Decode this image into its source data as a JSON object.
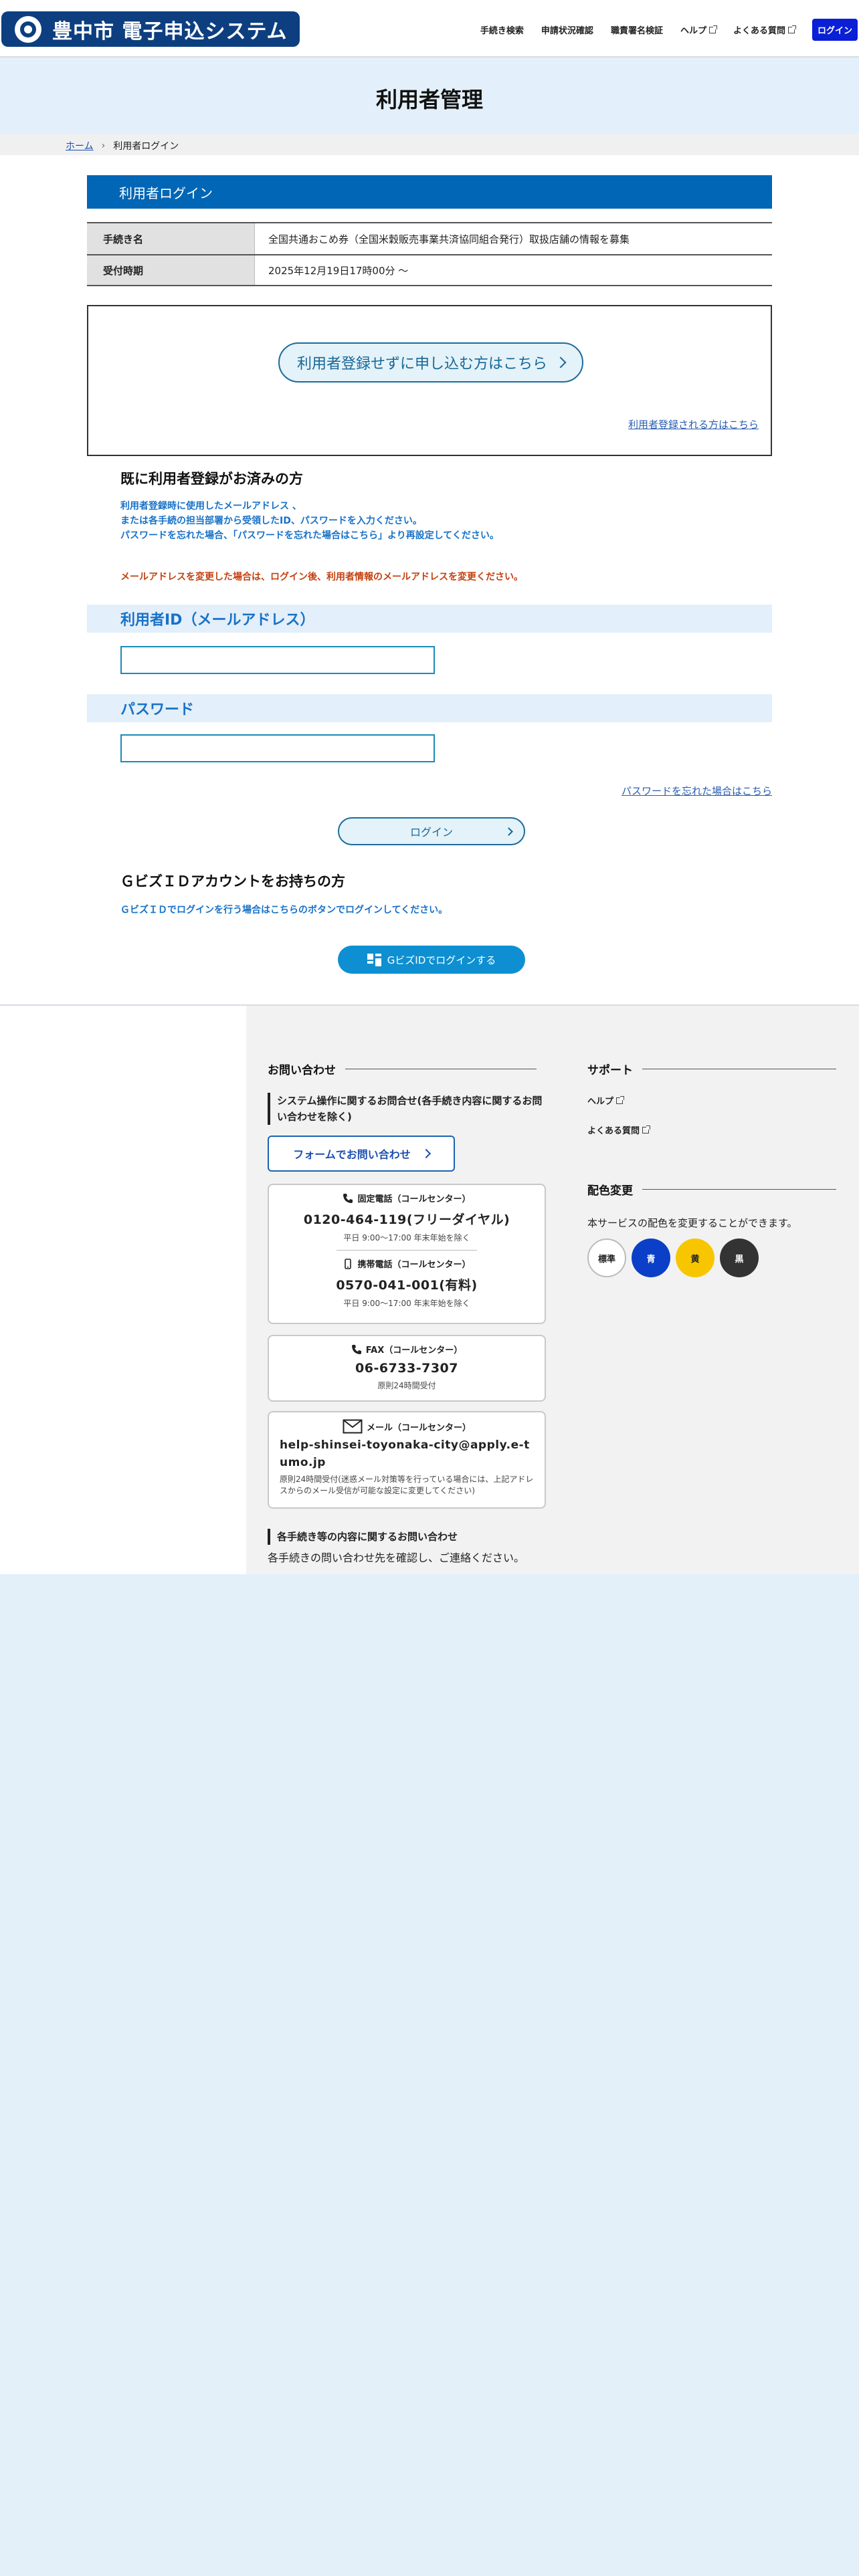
{
  "header": {
    "logo_text": "豊中市 電子申込システム",
    "nav": [
      "手続き検索",
      "申請状況確認",
      "職責署名検証",
      "ヘルプ",
      "よくある質問"
    ],
    "login": "ログイン"
  },
  "page_title": "利用者管理",
  "breadcrumb": {
    "home": "ホーム",
    "current": "利用者ログイン"
  },
  "login_section": {
    "title": "利用者ログイン",
    "rows": [
      {
        "label": "手続き名",
        "value": "全国共通おこめ券（全国米穀販売事業共済協同組合発行）取扱店舗の情報を募集"
      },
      {
        "label": "受付時期",
        "value": "2025年12月19日17時00分 〜"
      }
    ],
    "apply_without_register": "利用者登録せずに申し込む方はこちら",
    "register_link": "利用者登録される方はこちら"
  },
  "existing": {
    "title": "既に利用者登録がお済みの方",
    "desc_lines": [
      "利用者登録時に使用したメールアドレス 、",
      "または各手続の担当部署から受領したID、パスワードを入力ください。",
      "パスワードを忘れた場合、「パスワードを忘れた場合はこちら」より再設定してください。"
    ],
    "warning": "メールアドレスを変更した場合は、ログイン後、利用者情報のメールアドレスを変更ください。",
    "user_id_label": "利用者ID（メールアドレス）",
    "password_label": "パスワード",
    "forgot_link": "パスワードを忘れた場合はこちら",
    "login_button": "ログイン"
  },
  "gbiz": {
    "title": "ＧビズＩＤアカウントをお持ちの方",
    "desc": "ＧビズＩＤでログインを行う場合はこちらのボタンでログインしてください。",
    "button": "GビズIDでログインする"
  },
  "footer": {
    "contact_heading": "お問い合わせ",
    "system_inquiry": "システム操作に関するお問合せ(各手続き内容に関するお問い合わせを除く)",
    "form_button": "フォームでお問い合わせ",
    "landline_label": "固定電話（コールセンター）",
    "landline_number": "0120-464-119(フリーダイヤル)",
    "landline_hours": "平日 9:00〜17:00 年末年始を除く",
    "mobile_label": "携帯電話（コールセンター）",
    "mobile_number": "0570-041-001(有料)",
    "mobile_hours": "平日 9:00〜17:00 年末年始を除く",
    "fax_label": "FAX（コールセンター）",
    "fax_number": "06-6733-7307",
    "fax_hours": "原則24時間受付",
    "mail_label": "メール（コールセンター）",
    "mail_address": "help-shinsei-toyonaka-city@apply.e-tumo.jp",
    "mail_note": "原則24時間受付(迷惑メール対策等を行っている場合には、上記アドレスからのメール受信が可能な設定に変更してください)",
    "procedure_inquiry": "各手続き等の内容に関するお問い合わせ",
    "procedure_text": "各手続きの問い合わせ先を確認し、ご連絡ください。",
    "support_heading": "サポート",
    "support_items": [
      "ヘルプ",
      "よくある質問"
    ],
    "color_heading": "配色変更",
    "color_desc": "本サービスの配色を変更することができます。",
    "swatches": [
      {
        "label": "標準",
        "bg": "#ffffff",
        "fg": "#222222"
      },
      {
        "label": "青",
        "bg": "#0b3fc7",
        "fg": "#ffffff"
      },
      {
        "label": "黄",
        "bg": "#f7c600",
        "fg": "#222222"
      },
      {
        "label": "黒",
        "bg": "#333333",
        "fg": "#ffffff"
      }
    ]
  }
}
